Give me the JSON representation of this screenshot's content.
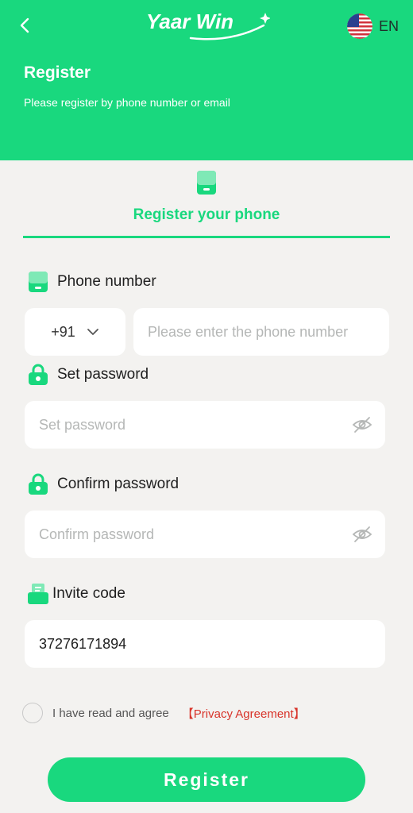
{
  "header": {
    "title": "Register",
    "subtitle": "Please register by phone number or email",
    "logo_text": "Yaar Win",
    "language": "EN"
  },
  "tab": {
    "label": "Register your phone"
  },
  "form": {
    "phone": {
      "label": "Phone number",
      "country_code": "+91",
      "placeholder": "Please enter the phone number"
    },
    "password": {
      "label": "Set password",
      "placeholder": "Set password"
    },
    "confirm": {
      "label": "Confirm password",
      "placeholder": "Confirm password"
    },
    "invite": {
      "label": "Invite code",
      "value": "37276171894"
    }
  },
  "agreement": {
    "text": "I have read and agree",
    "link": "【Privacy Agreement】"
  },
  "register_button": "Register",
  "colors": {
    "brand": "#19d87e",
    "link": "#d8342a",
    "background": "#f3f2f0"
  },
  "icons": [
    "back-arrow-icon",
    "us-flag-icon",
    "phone-icon",
    "lock-icon",
    "invite-icon",
    "eye-off-icon",
    "chevron-down-icon"
  ]
}
